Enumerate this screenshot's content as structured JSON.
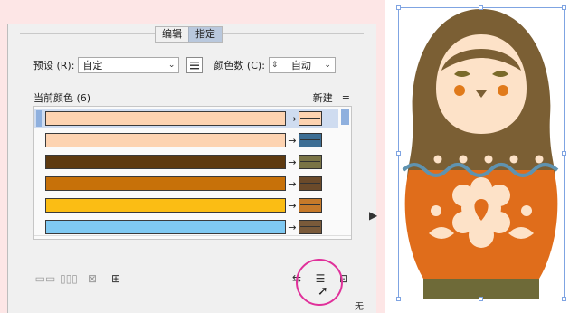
{
  "tabs": [
    {
      "label": "编辑",
      "active": false
    },
    {
      "label": "指定",
      "active": true
    }
  ],
  "preset": {
    "label": "预设 (R):",
    "value": "自定"
  },
  "color_count": {
    "label": "颜色数 (C):",
    "value": "自动"
  },
  "list": {
    "header": "当前颜色 (6)",
    "new_label": "新建",
    "rows": [
      {
        "current": "#fdd3b1",
        "new": "#fdd3b1",
        "selected": true
      },
      {
        "current": "#fdd3b1",
        "new": "#3d6e94",
        "selected": false
      },
      {
        "current": "#5e3a10",
        "new": "#7a7446",
        "selected": false
      },
      {
        "current": "#c77109",
        "new": "#6b4a2a",
        "selected": false
      },
      {
        "current": "#fbbd14",
        "new": "#c77a2a",
        "selected": false
      },
      {
        "current": "#7fc9f2",
        "new": "#7a5a3a",
        "selected": false
      }
    ]
  },
  "footer_text": "无",
  "colors": {
    "tab_active": "#b9c8dd",
    "selection": "#cfdcf0",
    "highlight_ring": "#e0309a",
    "bounding_box": "#7fa4e2"
  },
  "doll_colors": {
    "hood": "#7b5f34",
    "face": "#fde2c8",
    "body": "#e06d1b",
    "eyes": "#7a6a2a",
    "cheeks": "#e07a1b",
    "wave": "#5f93b0",
    "flower": "#fde2c8",
    "base": "#6e6a38"
  }
}
